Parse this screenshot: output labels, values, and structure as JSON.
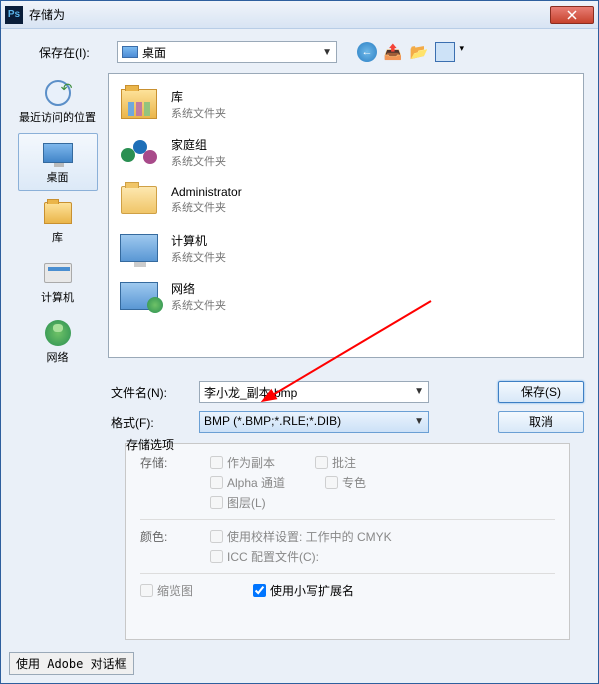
{
  "titlebar": {
    "title": "存储为"
  },
  "toprow": {
    "save_in_label": "保存在(I):",
    "location": "桌面"
  },
  "sidebar": {
    "recent": "最近访问的位置",
    "desktop": "桌面",
    "library": "库",
    "computer": "计算机",
    "network": "网络"
  },
  "filelist": [
    {
      "name": "库",
      "sub": "系统文件夹"
    },
    {
      "name": "家庭组",
      "sub": "系统文件夹"
    },
    {
      "name": "Administrator",
      "sub": "系统文件夹"
    },
    {
      "name": "计算机",
      "sub": "系统文件夹"
    },
    {
      "name": "网络",
      "sub": "系统文件夹"
    }
  ],
  "form": {
    "filename_label": "文件名(N):",
    "filename_value": "李小龙_副本.bmp",
    "format_label": "格式(F):",
    "format_value": "BMP (*.BMP;*.RLE;*.DIB)",
    "save_btn": "保存(S)",
    "cancel_btn": "取消"
  },
  "options": {
    "group_title": "存储选项",
    "store_label": "存储:",
    "as_copy": "作为副本",
    "annotations": "批注",
    "alpha": "Alpha 通道",
    "spot": "专色",
    "layers": "图层(L)",
    "color_label": "颜色:",
    "proof": "使用校样设置: 工作中的 CMYK",
    "icc": "ICC 配置文件(C):",
    "thumbnail": "缩览图",
    "lowercase": "使用小写扩展名"
  },
  "footer": {
    "adobe_btn": "使用 Adobe 对话框"
  }
}
